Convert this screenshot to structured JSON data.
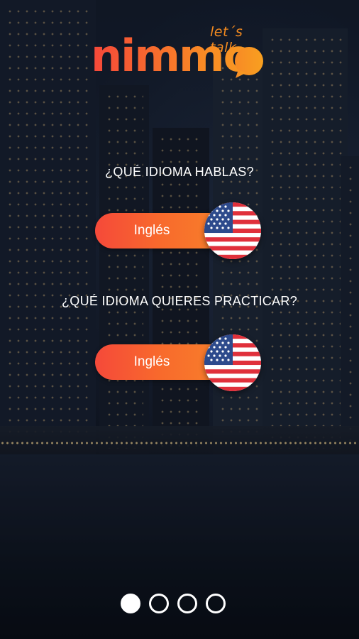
{
  "brand": {
    "name": "nimmo",
    "tagline": "let´s talk",
    "accent_start": "#f5473a",
    "accent_end": "#f89a22"
  },
  "native_language": {
    "question": "¿QUÉ IDIOMA HABLAS?",
    "selected": "Inglés",
    "flag_icon": "us-flag-icon"
  },
  "practice_language": {
    "question": "¿QUÉ IDIOMA QUIERES PRACTICAR?",
    "selected": "Inglés",
    "flag_icon": "us-flag-icon"
  },
  "pager": {
    "total_pages": 4,
    "current_page": 1
  }
}
